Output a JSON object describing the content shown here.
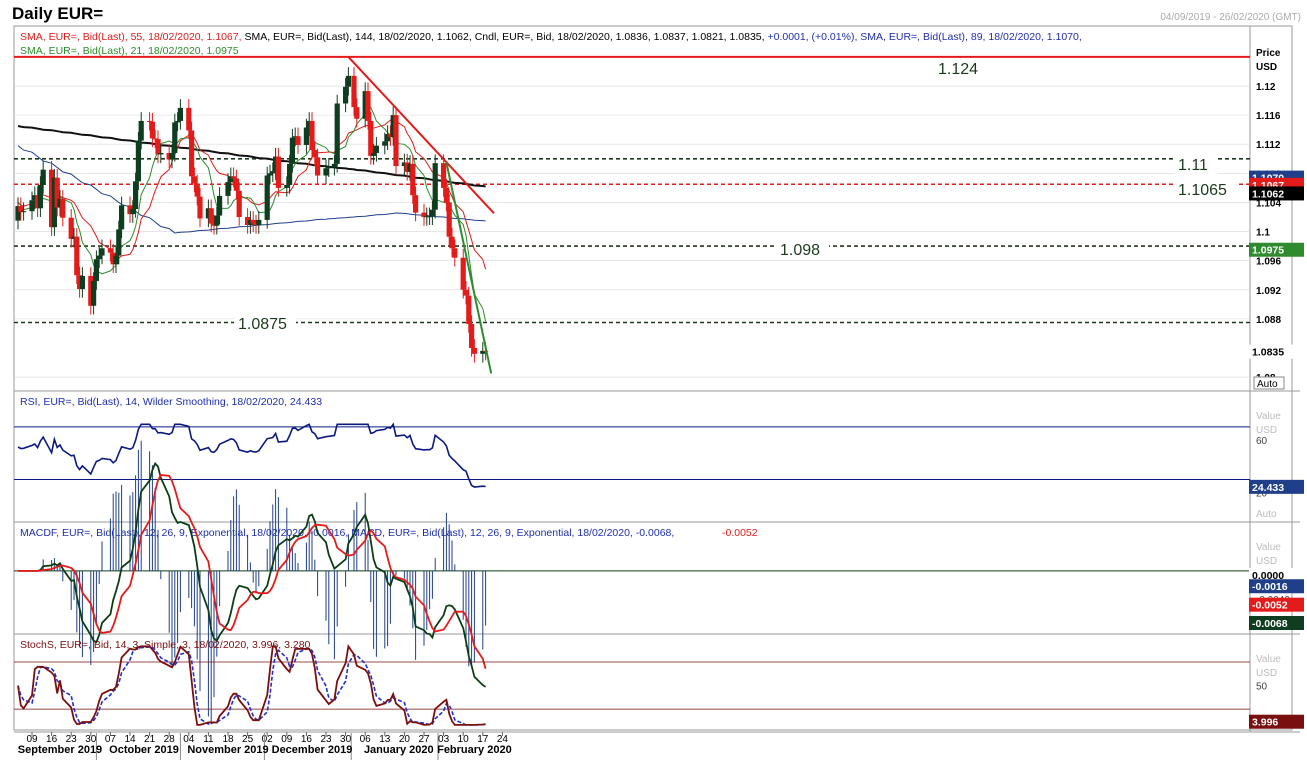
{
  "header": {
    "title": "Daily EUR=",
    "date_range": "04/09/2019 - 26/02/2020 (GMT)"
  },
  "colors": {
    "up": "#0f3d1f",
    "down": "#e31b1b",
    "sma55": "#e31b1b",
    "sma144": "#111111",
    "sma89": "#1f3f8a",
    "sma21": "#2e8b2e",
    "rsi": "#0a1a80",
    "macd_line": "#0d3d14",
    "macd_signal": "#e31b1b",
    "macd_hist": "#1f3f8a",
    "stoch_k": "#7a0f0f",
    "stoch_d": "#1f2fd0",
    "badge_blue": "#1f3f8a",
    "badge_red": "#e31b1b",
    "badge_green": "#2e8b2e"
  },
  "panes": {
    "price": {
      "legend_line1": [
        {
          "text": "SMA, EUR=, Bid(Last), 55, 18/02/2020, 1.1067, ",
          "color": "red"
        },
        {
          "text": "SMA, EUR=, Bid(Last), 144, 18/02/2020, 1.1062, ",
          "color": "black"
        },
        {
          "text": "Cndl, EUR=, Bid, 18/02/2020, 1.0836, 1.0837, 1.0821, 1.0835, ",
          "color": "black"
        },
        {
          "text": "+0.0001, (+0.01%), ",
          "color": "blue"
        },
        {
          "text": "SMA, EUR=, Bid(Last), 89, 18/02/2020, 1.1070,",
          "color": "blue"
        }
      ],
      "legend_line2": [
        {
          "text": "SMA, EUR=, Bid(Last), 21, 18/02/2020, 1.0975",
          "color": "green"
        }
      ],
      "axis_title": "Price",
      "axis_unit": "USD",
      "auto_label": "Auto"
    },
    "rsi": {
      "legend": "RSI, EUR=, Bid(Last), 14, Wilder Smoothing, 18/02/2020, 24.433",
      "axis_title": "Value",
      "axis_unit": "USD",
      "auto_label": "Auto",
      "badge": "24.433"
    },
    "macd": {
      "legend_a": "MACDF, EUR=, Bid(Last), 12, 26, 9, Exponential, 18/02/2020, -0.0016, ",
      "legend_b": "MACD, EUR=, Bid(Last), 12, 26, 9, Exponential, 18/02/2020, -0.0068, ",
      "legend_c": "-0.0052",
      "axis_title": "Value",
      "axis_unit": "USD",
      "badges": [
        "0.0000",
        "-0.0016",
        "-0.0052",
        "-0.0068"
      ]
    },
    "stoch": {
      "legend": "StochS, EUR=, Bid, 14, 3, Simple, 3, 18/02/2020, 3.996, 3.280",
      "axis_title": "Value",
      "axis_unit": "USD",
      "badge": "3.996"
    }
  },
  "chart_data": {
    "type": "candlestick",
    "title": "Daily EUR=",
    "x_dates": [
      "2019-09-04",
      "2019-09-05",
      "2019-09-06",
      "2019-09-09",
      "2019-09-10",
      "2019-09-11",
      "2019-09-12",
      "2019-09-13",
      "2019-09-16",
      "2019-09-17",
      "2019-09-18",
      "2019-09-19",
      "2019-09-20",
      "2019-09-23",
      "2019-09-24",
      "2019-09-25",
      "2019-09-26",
      "2019-09-27",
      "2019-09-30",
      "2019-10-01",
      "2019-10-02",
      "2019-10-03",
      "2019-10-04",
      "2019-10-07",
      "2019-10-08",
      "2019-10-09",
      "2019-10-10",
      "2019-10-11",
      "2019-10-14",
      "2019-10-15",
      "2019-10-16",
      "2019-10-17",
      "2019-10-18",
      "2019-10-21",
      "2019-10-22",
      "2019-10-23",
      "2019-10-24",
      "2019-10-25",
      "2019-10-28",
      "2019-10-29",
      "2019-10-30",
      "2019-10-31",
      "2019-11-01",
      "2019-11-04",
      "2019-11-05",
      "2019-11-06",
      "2019-11-07",
      "2019-11-08",
      "2019-11-11",
      "2019-11-12",
      "2019-11-13",
      "2019-11-14",
      "2019-11-15",
      "2019-11-18",
      "2019-11-19",
      "2019-11-20",
      "2019-11-21",
      "2019-11-22",
      "2019-11-25",
      "2019-11-26",
      "2019-11-27",
      "2019-11-28",
      "2019-11-29",
      "2019-12-02",
      "2019-12-03",
      "2019-12-04",
      "2019-12-05",
      "2019-12-06",
      "2019-12-09",
      "2019-12-10",
      "2019-12-11",
      "2019-12-12",
      "2019-12-13",
      "2019-12-16",
      "2019-12-17",
      "2019-12-18",
      "2019-12-19",
      "2019-12-20",
      "2019-12-23",
      "2019-12-24",
      "2019-12-26",
      "2019-12-27",
      "2019-12-30",
      "2019-12-31",
      "2020-01-02",
      "2020-01-03",
      "2020-01-06",
      "2020-01-07",
      "2020-01-08",
      "2020-01-09",
      "2020-01-10",
      "2020-01-13",
      "2020-01-14",
      "2020-01-15",
      "2020-01-16",
      "2020-01-17",
      "2020-01-20",
      "2020-01-21",
      "2020-01-22",
      "2020-01-23",
      "2020-01-24",
      "2020-01-27",
      "2020-01-28",
      "2020-01-29",
      "2020-01-30",
      "2020-01-31",
      "2020-02-03",
      "2020-02-04",
      "2020-02-05",
      "2020-02-06",
      "2020-02-07",
      "2020-02-10",
      "2020-02-11",
      "2020-02-12",
      "2020-02-13",
      "2020-02-14",
      "2020-02-17",
      "2020-02-18"
    ],
    "close": [
      1.1035,
      1.1027,
      1.1028,
      1.1043,
      1.105,
      1.1032,
      1.1064,
      1.1085,
      1.1006,
      1.1074,
      1.1033,
      1.1045,
      1.1019,
      1.099,
      1.0993,
      1.094,
      1.0921,
      1.0939,
      1.0898,
      1.0932,
      1.0962,
      1.0967,
      1.0977,
      1.0971,
      1.0955,
      1.0967,
      1.1003,
      1.1036,
      1.1024,
      1.1031,
      1.1069,
      1.1125,
      1.1152,
      1.1151,
      1.1128,
      1.1127,
      1.1106,
      1.1108,
      1.1099,
      1.1108,
      1.115,
      1.1152,
      1.117,
      1.1139,
      1.1076,
      1.1066,
      1.1048,
      1.1018,
      1.1032,
      1.1011,
      1.1008,
      1.1022,
      1.1049,
      1.1068,
      1.1076,
      1.1073,
      1.1056,
      1.102,
      1.1009,
      1.1016,
      1.1011,
      1.1009,
      1.1016,
      1.1077,
      1.108,
      1.1083,
      1.1103,
      1.106,
      1.1064,
      1.1093,
      1.1129,
      1.1131,
      1.1119,
      1.1143,
      1.1152,
      1.1112,
      1.1102,
      1.1077,
      1.1087,
      1.1089,
      1.1093,
      1.1176,
      1.1199,
      1.1214,
      1.1171,
      1.1155,
      1.1193,
      1.1152,
      1.1104,
      1.1108,
      1.1118,
      1.1124,
      1.1134,
      1.113,
      1.116,
      1.109,
      1.1095,
      1.1082,
      1.1093,
      1.105,
      1.1026,
      1.102,
      1.1021,
      1.1021,
      1.103,
      1.1094,
      1.106,
      1.104,
      1.0993,
      1.0977,
      1.0964,
      1.092,
      1.0912,
      1.0873,
      1.084,
      1.0832,
      1.0836,
      1.0835
    ],
    "sma_lines": [
      {
        "name": "SMA 55",
        "value": 1.1067
      },
      {
        "name": "SMA 144",
        "value": 1.1062
      },
      {
        "name": "SMA 89",
        "value": 1.107
      },
      {
        "name": "SMA 21",
        "value": 1.0975
      }
    ],
    "last_price": "1.0835",
    "y_axis_ticks": [
      "1.12",
      "1.116",
      "1.112",
      "1.108",
      "1.104",
      "1.1",
      "1.096",
      "1.092",
      "1.088",
      "1.08"
    ],
    "ylim": [
      1.0785,
      1.1255
    ],
    "horizontal_levels": [
      {
        "value": 1.124,
        "label": "1.124",
        "style": "solid",
        "color": "red"
      },
      {
        "value": 1.11,
        "label": "1.11",
        "style": "dashed",
        "color": "black"
      },
      {
        "value": 1.1065,
        "label": "1.1065",
        "style": "dashed",
        "color": "red"
      },
      {
        "value": 1.098,
        "label": "1.098",
        "style": "dashed",
        "color": "black"
      },
      {
        "value": 1.0875,
        "label": "1.0875",
        "style": "dashed",
        "color": "black"
      }
    ],
    "trendlines": [
      {
        "color": "red",
        "from": [
          "2019-12-31",
          1.124
        ],
        "to": [
          "2020-02-21",
          1.1025
        ]
      },
      {
        "color": "green",
        "from": [
          "2020-02-04",
          1.1095
        ],
        "to": [
          "2020-02-20",
          1.0805
        ]
      }
    ],
    "x_tick_labels": [
      "09",
      "16",
      "23",
      "30",
      "07",
      "14",
      "21",
      "28",
      "04",
      "11",
      "18",
      "25",
      "02",
      "09",
      "16",
      "23",
      "30",
      "06",
      "13",
      "20",
      "27",
      "03",
      "10",
      "17",
      "24"
    ],
    "month_labels": [
      "September 2019",
      "October 2019",
      "November 2019",
      "December 2019",
      "January 2020",
      "February 2020"
    ],
    "rsi": {
      "last": 24.433,
      "levels": [
        70,
        30
      ],
      "y_ticks": [
        "60",
        "20"
      ]
    },
    "macd": {
      "macd": -0.0068,
      "signal": -0.0052,
      "histogram": -0.0016,
      "y_ticks": [
        "-0.0040"
      ]
    },
    "stoch": {
      "k": 3.996,
      "d": 3.28,
      "levels": [
        80,
        20
      ],
      "y_ticks": [
        "50"
      ]
    }
  }
}
